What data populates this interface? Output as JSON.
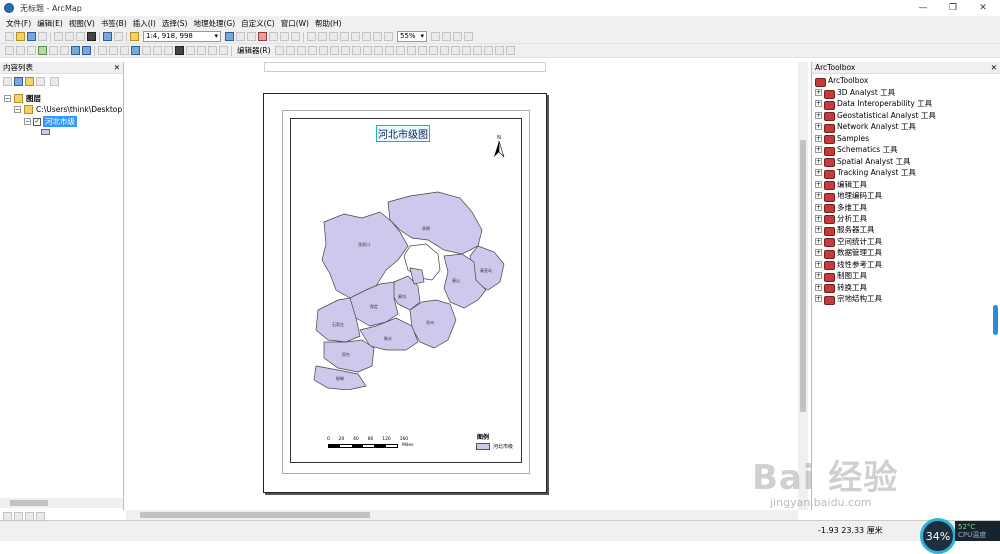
{
  "window": {
    "title": "无标题 - ArcMap"
  },
  "menu": [
    "文件(F)",
    "编辑(E)",
    "视图(V)",
    "书签(B)",
    "插入(I)",
    "选择(S)",
    "地理处理(G)",
    "自定义(C)",
    "窗口(W)",
    "帮助(H)"
  ],
  "toolbar": {
    "scale": "1:4, 918, 998",
    "zoom": "55%",
    "editor_label": "编辑器(R)"
  },
  "toc": {
    "title": "内容列表",
    "layers_root": "图层",
    "folder": "C:\\Users\\think\\Desktop",
    "layer": "河北市级"
  },
  "layout": {
    "map_title": "河北市级图",
    "north_label": "N",
    "scale_ticks": [
      "0",
      "20",
      "40",
      "80",
      "120",
      "160"
    ],
    "scale_unit": "Miles",
    "legend_title": "图例",
    "legend_item": "河北市级",
    "region_labels": [
      "承德",
      "张家口",
      "秦皇岛",
      "唐山",
      "廊坊",
      "保定",
      "沧州",
      "石家庄",
      "衡水",
      "邢台",
      "邯郸"
    ]
  },
  "toolbox": {
    "title": "ArcToolbox",
    "root": "ArcToolbox",
    "items": [
      "3D Analyst 工具",
      "Data Interoperability 工具",
      "Geostatistical Analyst 工具",
      "Network Analyst 工具",
      "Samples",
      "Schematics 工具",
      "Spatial Analyst 工具",
      "Tracking Analyst 工具",
      "编辑工具",
      "地理编码工具",
      "多维工具",
      "分析工具",
      "服务器工具",
      "空间统计工具",
      "数据管理工具",
      "线性参考工具",
      "制图工具",
      "转换工具",
      "宗地结构工具"
    ]
  },
  "status": {
    "coords": "-1.93  23.33 厘米",
    "cpu": "34%",
    "temp": "52°C",
    "cpu_label": "CPU温度"
  },
  "watermark": {
    "brand": "Bai 经验",
    "url": "jingyan.baidu.com"
  },
  "colors": {
    "region_fill": "#cfc7ec",
    "selection": "#3399ff",
    "accent": "#2db3d6"
  }
}
